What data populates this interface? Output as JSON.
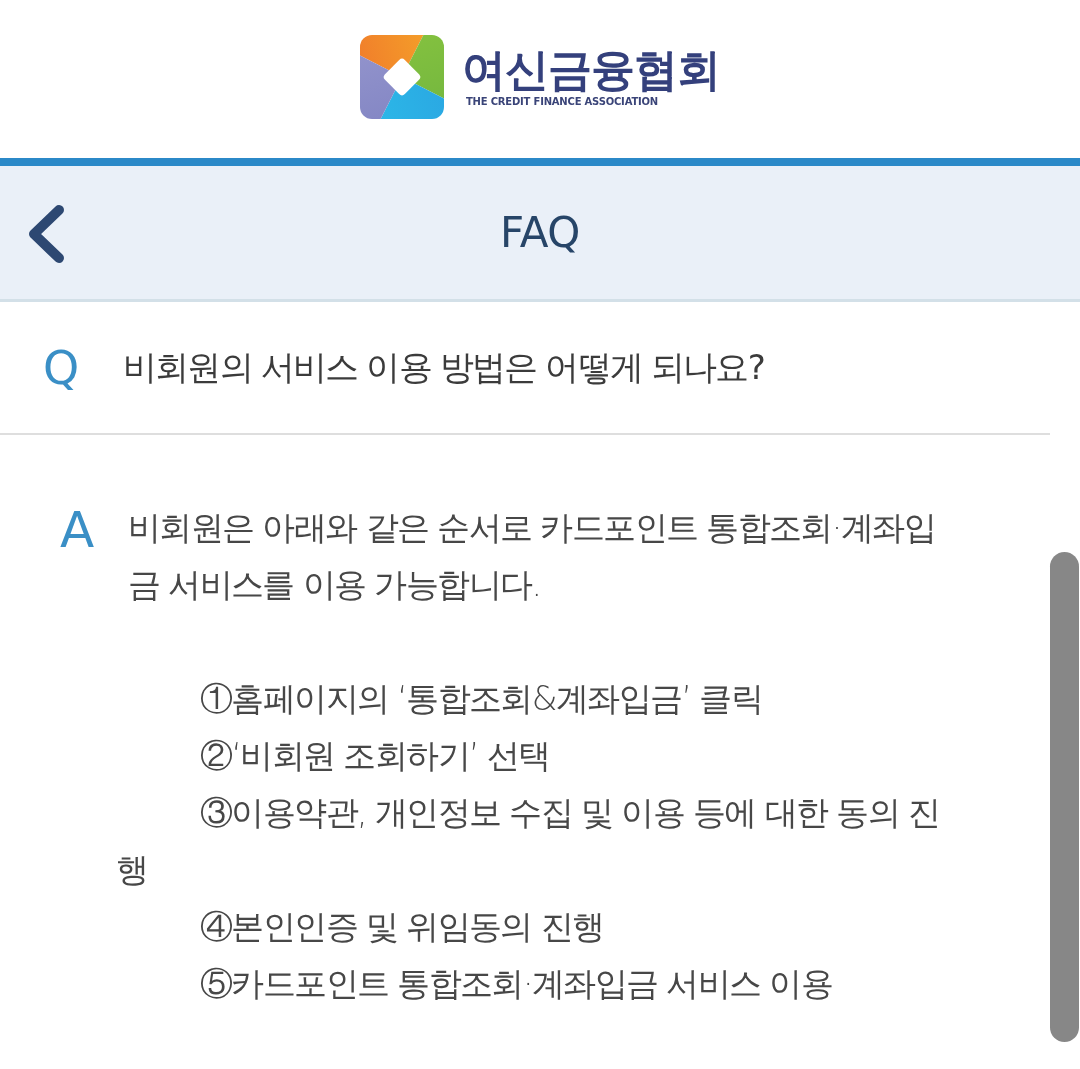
{
  "logo": {
    "name": "여신금융협회",
    "subtitle": "THE CREDIT FINANCE ASSOCIATION"
  },
  "header": {
    "title": "FAQ"
  },
  "question": {
    "marker": "Q",
    "text": "비회원의 서비스 이용 방법은 어떻게 되나요?"
  },
  "answer": {
    "marker": "A",
    "text": "비회원은 아래와 같은 순서로 카드포인트 통합조회·계좌입금 서비스를 이용 가능합니다.",
    "steps": [
      "①홈페이지의 ‘통합조회&계좌입금’ 클릭",
      "②‘비회원 조회하기’ 선택",
      "③이용약관, 개인정보 수집 및 이용 등에 대한 동의 진행",
      "④본인인증 및 위임동의 진행",
      "⑤카드포인트 통합조회·계좌입금 서비스 이용"
    ]
  }
}
